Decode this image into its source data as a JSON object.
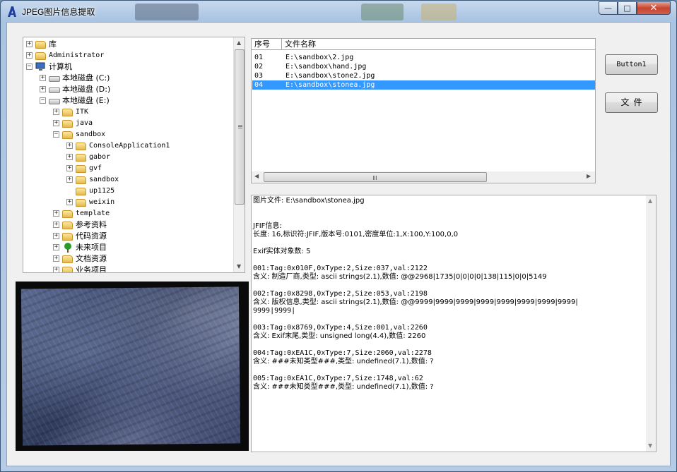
{
  "window": {
    "title": "JPEG图片信息提取",
    "min_glyph": "—",
    "max_glyph": "□",
    "close_glyph": "✕"
  },
  "tree": {
    "items": [
      {
        "label": "库",
        "expander": "+",
        "icon": "library-icon"
      },
      {
        "label": "Administrator",
        "expander": "+",
        "icon": "user-folder-icon"
      },
      {
        "label": "计算机",
        "expander": "−",
        "icon": "computer-icon"
      },
      {
        "label": "本地磁盘 (C:)",
        "expander": "+",
        "icon": "drive-icon"
      },
      {
        "label": "本地磁盘 (D:)",
        "expander": "+",
        "icon": "drive-icon"
      },
      {
        "label": "本地磁盘 (E:)",
        "expander": "−",
        "icon": "drive-icon"
      },
      {
        "label": "ITK",
        "expander": "+",
        "icon": "folder-icon"
      },
      {
        "label": "java",
        "expander": "+",
        "icon": "folder-icon"
      },
      {
        "label": "sandbox",
        "expander": "−",
        "icon": "folder-icon"
      },
      {
        "label": "ConsoleApplication1",
        "expander": "+",
        "icon": "folder-icon"
      },
      {
        "label": "gabor",
        "expander": "+",
        "icon": "folder-icon"
      },
      {
        "label": "gvf",
        "expander": "+",
        "icon": "folder-icon"
      },
      {
        "label": "sandbox",
        "expander": "+",
        "icon": "folder-icon"
      },
      {
        "label": "up1125",
        "expander": "",
        "icon": "folder-icon"
      },
      {
        "label": "weixin",
        "expander": "+",
        "icon": "folder-icon"
      },
      {
        "label": "template",
        "expander": "+",
        "icon": "folder-icon"
      },
      {
        "label": "参考资料",
        "expander": "+",
        "icon": "folder-icon"
      },
      {
        "label": "代码资源",
        "expander": "+",
        "icon": "folder-icon"
      },
      {
        "label": "未来项目",
        "expander": "+",
        "icon": "tree-icon"
      },
      {
        "label": "文档资源",
        "expander": "+",
        "icon": "folder-icon"
      },
      {
        "label": "业务项目",
        "expander": "+",
        "icon": "folder-icon"
      }
    ]
  },
  "filelist": {
    "columns": [
      "序号",
      "文件名称"
    ],
    "rows": [
      {
        "num": "01",
        "name": "E:\\sandbox\\2.jpg",
        "selected": false
      },
      {
        "num": "02",
        "name": "E:\\sandbox\\hand.jpg",
        "selected": false
      },
      {
        "num": "03",
        "name": "E:\\sandbox\\stone2.jpg",
        "selected": false
      },
      {
        "num": "04",
        "name": "E:\\sandbox\\stonea.jpg",
        "selected": true
      }
    ]
  },
  "buttons": {
    "button1": "Button1",
    "file": "文件"
  },
  "info": {
    "lines": [
      "图片文件: E:\\sandbox\\stonea.jpg",
      "",
      "",
      "JFIF信息:",
      "长度: 16,标识符:JFIF,版本号:0101,密度单位:1,X:100,Y:100,0,0",
      "",
      "Exif实体对象数: 5",
      "",
      "001:Tag:0x010F,0xType:2,Size:037,val:2122",
      "含义: 制造厂商,类型: ascii strings(2.1),数值: @@2968|1735|0|0|0|0|138|115|0|0|5149",
      "",
      "002:Tag:0x8298,0xType:2,Size:053,val:2198",
      "含义: 版权信息,类型: ascii strings(2.1),数值: @@9999|9999|9999|9999|9999|9999|9999|9999|",
      "9999|9999|",
      "",
      "003:Tag:0x8769,0xType:4,Size:001,val:2260",
      "含义: Exif末尾,类型: unsigned long(4.4),数值: 2260",
      "",
      "004:Tag:0xEA1C,0xType:7,Size:2060,val:2278",
      "含义: ###未知类型###,类型: undefined(7.1),数值: ?",
      "",
      "005:Tag:0xEA1C,0xType:7,Size:1748,val:62",
      "含义: ###未知类型###,类型: undefined(7.1),数值: ?"
    ]
  },
  "colors": {
    "selection": "#3399ff",
    "window_frame": "#b5cbe6"
  }
}
